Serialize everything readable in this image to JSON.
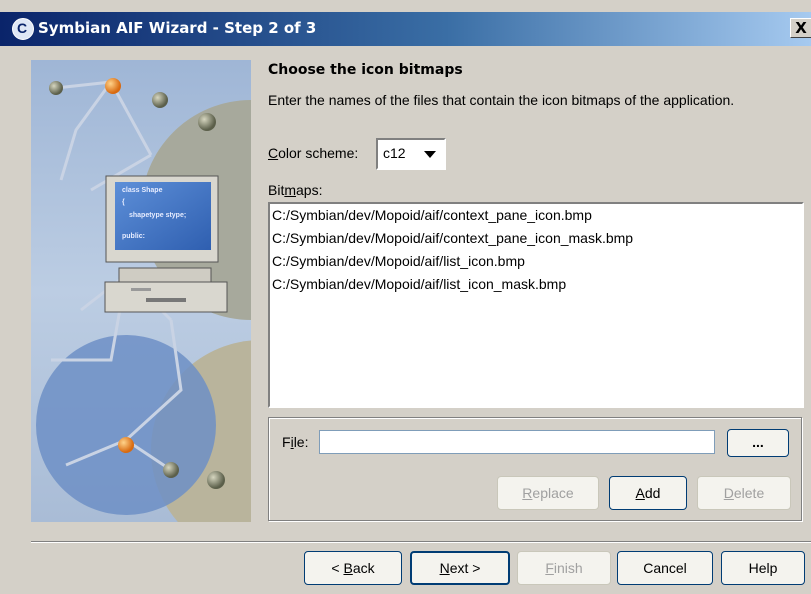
{
  "window": {
    "title": "Symbian AIF Wizard - Step 2 of 3",
    "close_glyph": "X"
  },
  "illustration": {
    "code_lines": [
      "class Shape",
      "{",
      "shapetype stype;",
      "public:"
    ]
  },
  "page": {
    "heading": "Choose the icon bitmaps",
    "description": "Enter the names of the files that contain the icon bitmaps of the application."
  },
  "color_scheme": {
    "label_pre": "",
    "label_mnemonic": "C",
    "label_post": "olor scheme:",
    "value": "c12"
  },
  "bitmaps": {
    "label_pre": "Bit",
    "label_mnemonic": "m",
    "label_post": "aps:",
    "items": [
      "C:/Symbian/dev/Mopoid/aif/context_pane_icon.bmp",
      "C:/Symbian/dev/Mopoid/aif/context_pane_icon_mask.bmp",
      "C:/Symbian/dev/Mopoid/aif/list_icon.bmp",
      "C:/Symbian/dev/Mopoid/aif/list_icon_mask.bmp"
    ]
  },
  "file_group": {
    "label_pre": "F",
    "label_mnemonic": "i",
    "label_post": "le:",
    "value": "",
    "browse_label": "...",
    "replace": {
      "pre": "",
      "mnemonic": "R",
      "post": "eplace"
    },
    "add": {
      "pre": "",
      "mnemonic": "A",
      "post": "dd"
    },
    "delete": {
      "pre": "",
      "mnemonic": "D",
      "post": "elete"
    }
  },
  "footer": {
    "back": {
      "pre": "< ",
      "mnemonic": "B",
      "post": "ack"
    },
    "next": {
      "pre": "",
      "mnemonic": "N",
      "post": "ext >"
    },
    "finish": {
      "pre": "",
      "mnemonic": "F",
      "post": "inish"
    },
    "cancel": "Cancel",
    "help": "Help"
  },
  "colors": {
    "title_bar_start": "#0a246a",
    "title_bar_end": "#a6caf0",
    "dialog_background": "#d4d0c8",
    "disabled_text": "#a0a0a0"
  }
}
